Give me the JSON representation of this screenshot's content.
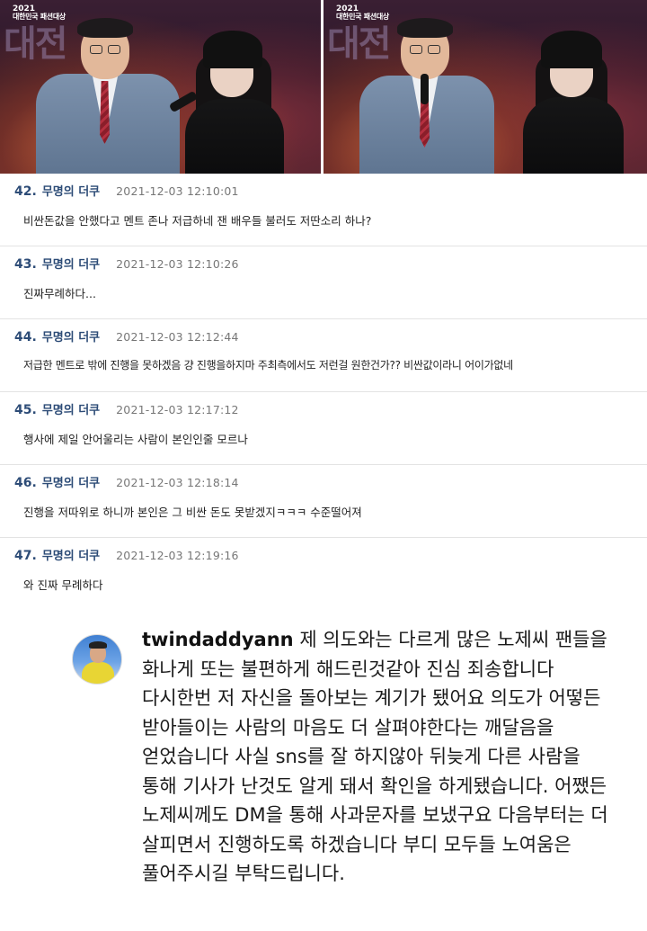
{
  "photos": {
    "left": {
      "watermark": "대전",
      "event_year": "2021",
      "event_name": "대한민국 패션대상"
    },
    "right": {
      "watermark": "대전",
      "event_year": "2021",
      "event_name": "대한민국 패션대상"
    }
  },
  "comments": [
    {
      "num": "42.",
      "author": "무명의 더쿠",
      "date": "2021-12-03 12:10:01",
      "text": "비싼돈값을 안했다고 멘트 존나 저급하네 잰 배우들 불러도 저딴소리 하나?"
    },
    {
      "num": "43.",
      "author": "무명의 더쿠",
      "date": "2021-12-03 12:10:26",
      "text": "진짜무례하다..."
    },
    {
      "num": "44.",
      "author": "무명의 더쿠",
      "date": "2021-12-03 12:12:44",
      "text": "저급한 멘트로 밖에 진행을 못하겠음 걍 진행을하지마 주최측에서도 저런걸 원한건가?? 비싼값이라니 어이가없네"
    },
    {
      "num": "45.",
      "author": "무명의 더쿠",
      "date": "2021-12-03 12:17:12",
      "text": "행사에 제일 안어울리는 사람이 본인인줄 모르나"
    },
    {
      "num": "46.",
      "author": "무명의 더쿠",
      "date": "2021-12-03 12:18:14",
      "text": "진행을 저따위로 하니까 본인은 그 비싼 돈도 못받겠지ㅋㅋㅋ 수준떨어져"
    },
    {
      "num": "47.",
      "author": "무명의 더쿠",
      "date": "2021-12-03 12:19:16",
      "text": "와 진짜 무례하다"
    }
  ],
  "instagram": {
    "username": "twindaddyann",
    "text": "제 의도와는 다르게 많은 노제씨 팬들을 화나게 또는 불편하게 해드린것같아 진심 죄송합니다 다시한번 저 자신을 돌아보는 계기가 됐어요 의도가 어떻든 받아들이는 사람의 마음도 더 살펴야한다는 깨달음을 얻었습니다 사실 sns를 잘 하지않아 뒤늦게 다른 사람을 통해 기사가 난것도 알게 돼서 확인을 하게됐습니다. 어쨌든 노제씨께도 DM을 통해 사과문자를 보냈구요 다음부터는 더 살피면서 진행하도록 하겠습니다 부디 모두들 노여움은 풀어주시길 부탁드립니다."
  },
  "colors": {
    "comment_meta": "#2d4c77",
    "date": "#777777",
    "divider": "#e3e3e3"
  },
  "icons": {
    "avatar": "profile-avatar-icon"
  }
}
